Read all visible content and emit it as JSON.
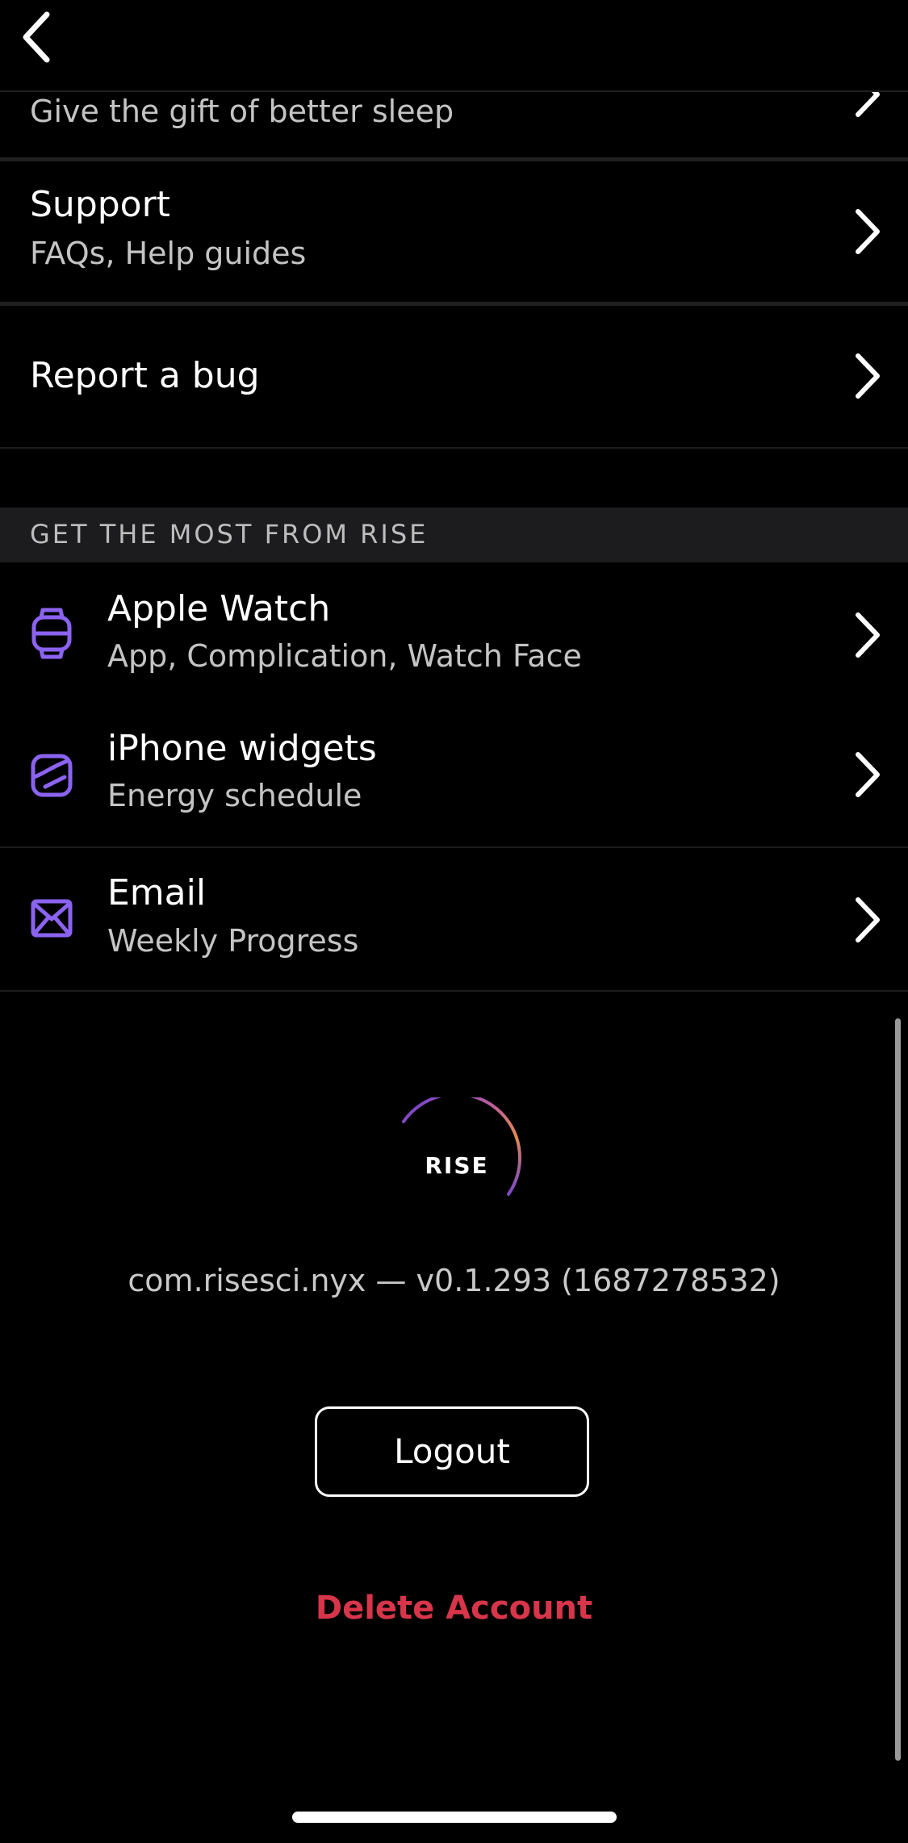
{
  "nav": {
    "back_icon": "chevron-left-icon"
  },
  "rows": {
    "gift": {
      "subtitle": "Give the gift of better sleep"
    },
    "support": {
      "title": "Support",
      "subtitle": "FAQs, Help guides"
    },
    "report_bug": {
      "title": "Report a bug"
    }
  },
  "section": {
    "header": "GET THE MOST FROM RISE",
    "items": [
      {
        "title": "Apple Watch",
        "subtitle": "App, Complication, Watch Face",
        "icon": "watch-icon"
      },
      {
        "title": "iPhone widgets",
        "subtitle": "Energy schedule",
        "icon": "widget-icon"
      },
      {
        "title": "Email",
        "subtitle": "Weekly Progress",
        "icon": "mail-icon"
      }
    ]
  },
  "footer": {
    "logo_text": "RISE",
    "version": "com.risesci.nyx — v0.1.293 (1687278532)",
    "logout_label": "Logout",
    "delete_label": "Delete Account"
  },
  "colors": {
    "background": "#000000",
    "accent_icon": "#8b63f0",
    "danger": "#d7354a",
    "section_header_bg": "#1c1c1e"
  }
}
